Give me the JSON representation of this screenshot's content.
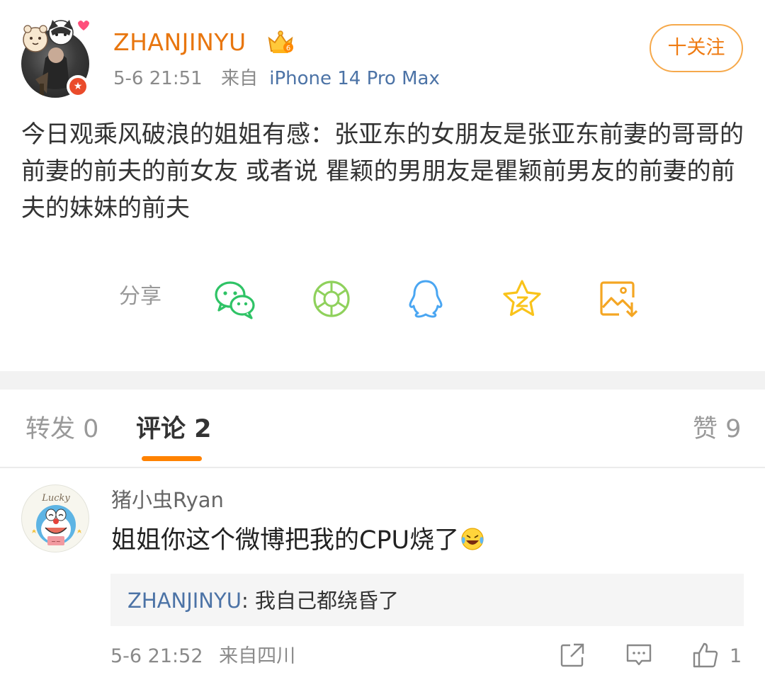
{
  "post": {
    "username": "ZHANJINYU",
    "time": "5-6 21:51",
    "source_prefix": "来自",
    "device": "iPhone 14 Pro Max",
    "follow_label": "十关注",
    "text": "今日观乘风破浪的姐姐有感：张亚东的女朋友是张亚东前妻的哥哥的前妻的前夫的前女友 或者说 瞿颖的男朋友是瞿颖前男友的前妻的前夫的妹妹的前夫"
  },
  "share": {
    "label": "分享",
    "icons": [
      "wechat-icon",
      "moments-icon",
      "qq-icon",
      "qzone-icon",
      "save-image-icon"
    ]
  },
  "tabs": {
    "repost": "转发 0",
    "comments": "评论 2",
    "likes": "赞 9"
  },
  "comment": {
    "username": "猪小虫Ryan",
    "text": "姐姐你这个微博把我的CPU烧了",
    "reply_user": "ZHANJINYU",
    "reply_text": ": 我自己都绕昏了",
    "time": "5-6 21:52",
    "source": "来自四川",
    "like_count": "1"
  },
  "colors": {
    "brand_orange": "#ff8200",
    "username_orange": "#e8760f",
    "link_blue": "#4c73a6",
    "wechat_green": "#2fc366",
    "qq_blue": "#4aa6f2",
    "qzone_yellow": "#f9c31a"
  }
}
